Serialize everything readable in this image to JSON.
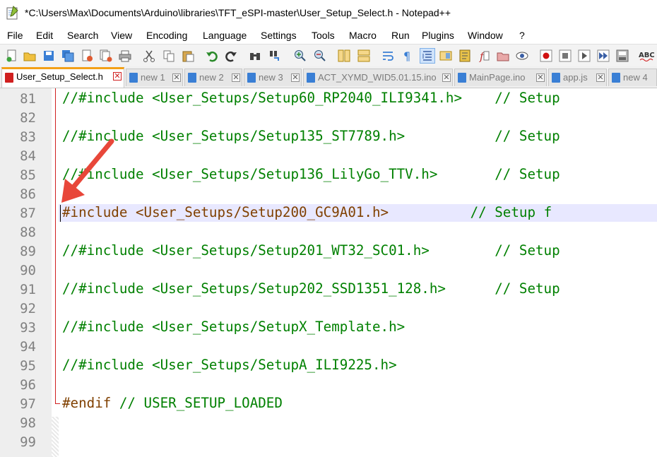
{
  "window": {
    "title": "*C:\\Users\\Max\\Documents\\Arduino\\libraries\\TFT_eSPI-master\\User_Setup_Select.h - Notepad++"
  },
  "menu": [
    "File",
    "Edit",
    "Search",
    "View",
    "Encoding",
    "Language",
    "Settings",
    "Tools",
    "Macro",
    "Run",
    "Plugins",
    "Window",
    "?"
  ],
  "toolbar_icons": [
    "new-file",
    "open-file",
    "save",
    "save-all",
    "close",
    "close-all",
    "print",
    "cut",
    "copy",
    "paste",
    "undo",
    "redo",
    "find",
    "replace",
    "zoom-in",
    "zoom-out",
    "sync-vertical",
    "sync-horizontal",
    "word-wrap",
    "show-all-chars",
    "indent-guide",
    "doc-map",
    "function-list",
    "doc-list",
    "folder-workspace",
    "monitor",
    "record-macro",
    "stop-record",
    "play-macro",
    "run-multiple",
    "save-macro",
    "spell-check"
  ],
  "tabs": [
    {
      "label": "User_Setup_Select.h",
      "active": true,
      "icon": "red-disk-icon",
      "color": "#d02020"
    },
    {
      "label": "new 1",
      "active": false,
      "icon": "blue-disk-icon",
      "color": "#3a7fd5"
    },
    {
      "label": "new 2",
      "active": false,
      "icon": "blue-disk-icon",
      "color": "#3a7fd5"
    },
    {
      "label": "new 3",
      "active": false,
      "icon": "blue-disk-icon",
      "color": "#3a7fd5"
    },
    {
      "label": "ACT_XYMD_WID5.01.15.ino",
      "active": false,
      "icon": "blue-disk-icon",
      "color": "#3a7fd5"
    },
    {
      "label": "MainPage.ino",
      "active": false,
      "icon": "blue-disk-icon",
      "color": "#3a7fd5"
    },
    {
      "label": "app.js",
      "active": false,
      "icon": "blue-disk-icon",
      "color": "#3a7fd5"
    },
    {
      "label": "new 4",
      "active": false,
      "icon": "blue-disk-icon",
      "color": "#3a7fd5"
    }
  ],
  "tab_close": "✕",
  "line_numbers": [
    "81",
    "82",
    "83",
    "84",
    "85",
    "86",
    "87",
    "88",
    "89",
    "90",
    "91",
    "92",
    "93",
    "94",
    "95",
    "96",
    "97",
    "98",
    "99"
  ],
  "code": [
    {
      "n": "81",
      "parts": [
        {
          "c": "cm",
          "t": "//#include <User_Setups/Setup60_RP2040_ILI9341.h>    // Setup"
        }
      ]
    },
    {
      "n": "82",
      "parts": []
    },
    {
      "n": "83",
      "parts": [
        {
          "c": "cm",
          "t": "//#include <User_Setups/Setup135_ST7789.h>           // Setup"
        }
      ]
    },
    {
      "n": "84",
      "parts": []
    },
    {
      "n": "85",
      "parts": [
        {
          "c": "cm",
          "t": "//#include <User_Setups/Setup136_LilyGo_TTV.h>       // Setup"
        }
      ]
    },
    {
      "n": "86",
      "parts": []
    },
    {
      "n": "87",
      "parts": [
        {
          "c": "pp",
          "t": "#include "
        },
        {
          "c": "inc",
          "t": "<User_Setups/Setup200_GC9A01.h>"
        },
        {
          "c": "cm",
          "t": "          // Setup f"
        }
      ]
    },
    {
      "n": "88",
      "parts": []
    },
    {
      "n": "89",
      "parts": [
        {
          "c": "cm",
          "t": "//#include <User_Setups/Setup201_WT32_SC01.h>        // Setup"
        }
      ]
    },
    {
      "n": "90",
      "parts": []
    },
    {
      "n": "91",
      "parts": [
        {
          "c": "cm",
          "t": "//#include <User_Setups/Setup202_SSD1351_128.h>      // Setup"
        }
      ]
    },
    {
      "n": "92",
      "parts": []
    },
    {
      "n": "93",
      "parts": [
        {
          "c": "cm",
          "t": "//#include <User_Setups/SetupX_Template.h>"
        }
      ]
    },
    {
      "n": "94",
      "parts": []
    },
    {
      "n": "95",
      "parts": [
        {
          "c": "cm",
          "t": "//#include <User_Setups/SetupA_ILI9225.h>"
        }
      ]
    },
    {
      "n": "96",
      "parts": []
    },
    {
      "n": "97",
      "parts": [
        {
          "c": "pp",
          "t": "#endif "
        },
        {
          "c": "cm",
          "t": "// USER_SETUP_LOADED"
        }
      ]
    },
    {
      "n": "98",
      "parts": []
    },
    {
      "n": "99",
      "parts": []
    }
  ],
  "colors": {
    "comment": "#008000",
    "preprocessor": "#804000",
    "current_line": "#e8e8ff",
    "annotation_arrow": "#e8473a"
  }
}
